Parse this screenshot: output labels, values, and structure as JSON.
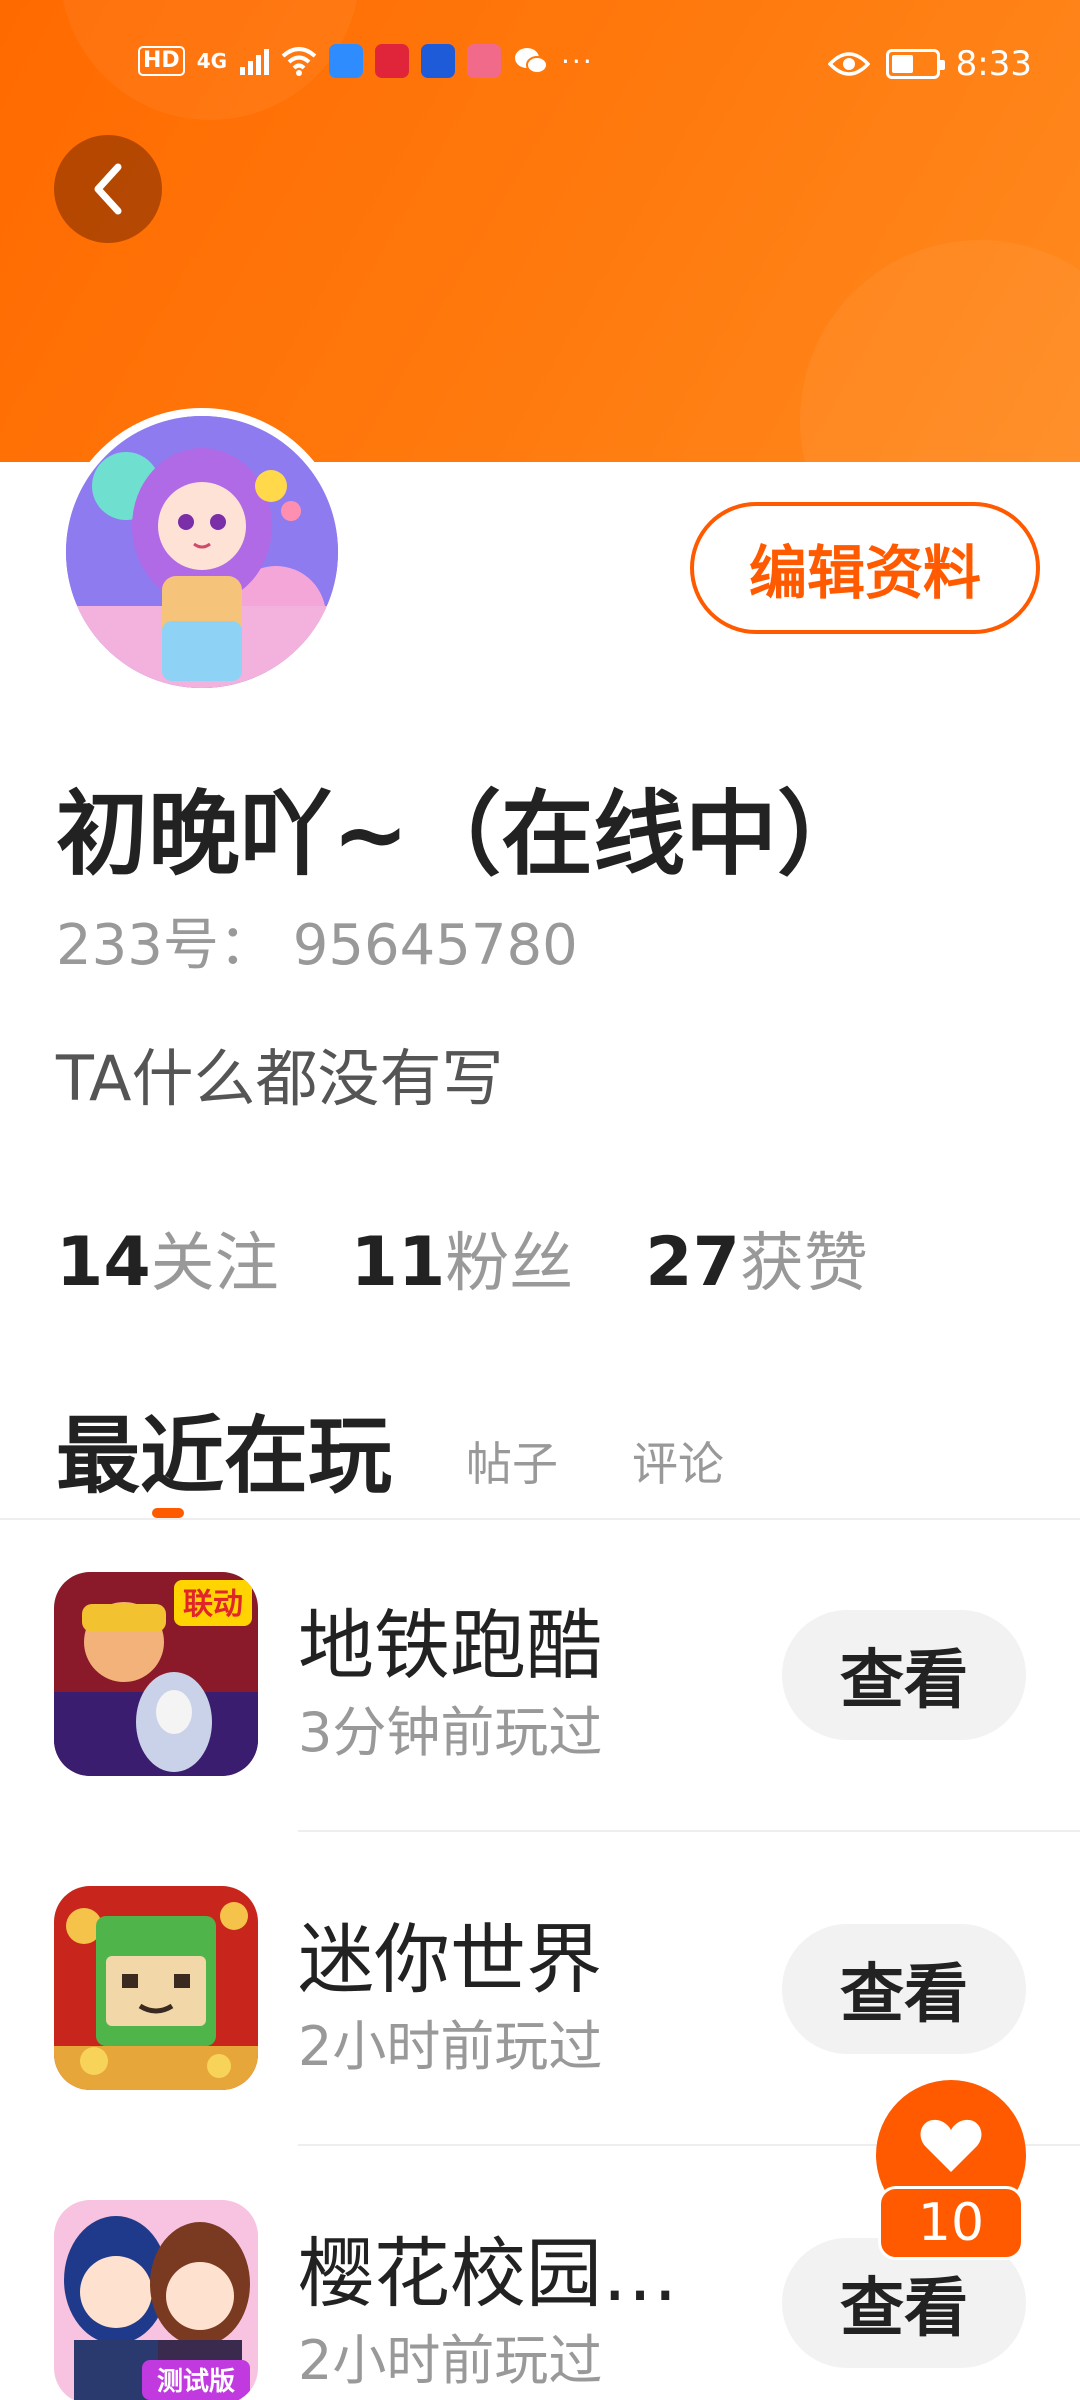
{
  "status_bar": {
    "hd": "HD",
    "network": "4G",
    "time": "8:33",
    "battery_level": 0.5,
    "overflow": "···"
  },
  "header": {
    "back_icon": "chevron-left-icon",
    "edit_label": "编辑资料"
  },
  "profile": {
    "nickname": "初晚吖~（在线中）",
    "uid": "233号：  95645780",
    "bio": "TA什么都没有写"
  },
  "stats": [
    {
      "num": "14",
      "label": "关注"
    },
    {
      "num": "11",
      "label": "粉丝"
    },
    {
      "num": "27",
      "label": "获赞"
    }
  ],
  "tabs": [
    {
      "label": "最近在玩"
    },
    {
      "label": "帖子"
    },
    {
      "label": "评论"
    }
  ],
  "games": [
    {
      "name": "地铁跑酷",
      "time": "3分钟前玩过",
      "button": "查看",
      "badge": "联动"
    },
    {
      "name": "迷你世界",
      "time": "2小时前玩过",
      "button": "查看"
    },
    {
      "name": "樱花校园…",
      "time": "2小时前玩过",
      "button": "查看",
      "badge": "测试版"
    }
  ],
  "like": {
    "count": "10",
    "icon": "heart-icon"
  },
  "colors": {
    "accent": "#ff5a00",
    "header": "#ff7a0e"
  }
}
